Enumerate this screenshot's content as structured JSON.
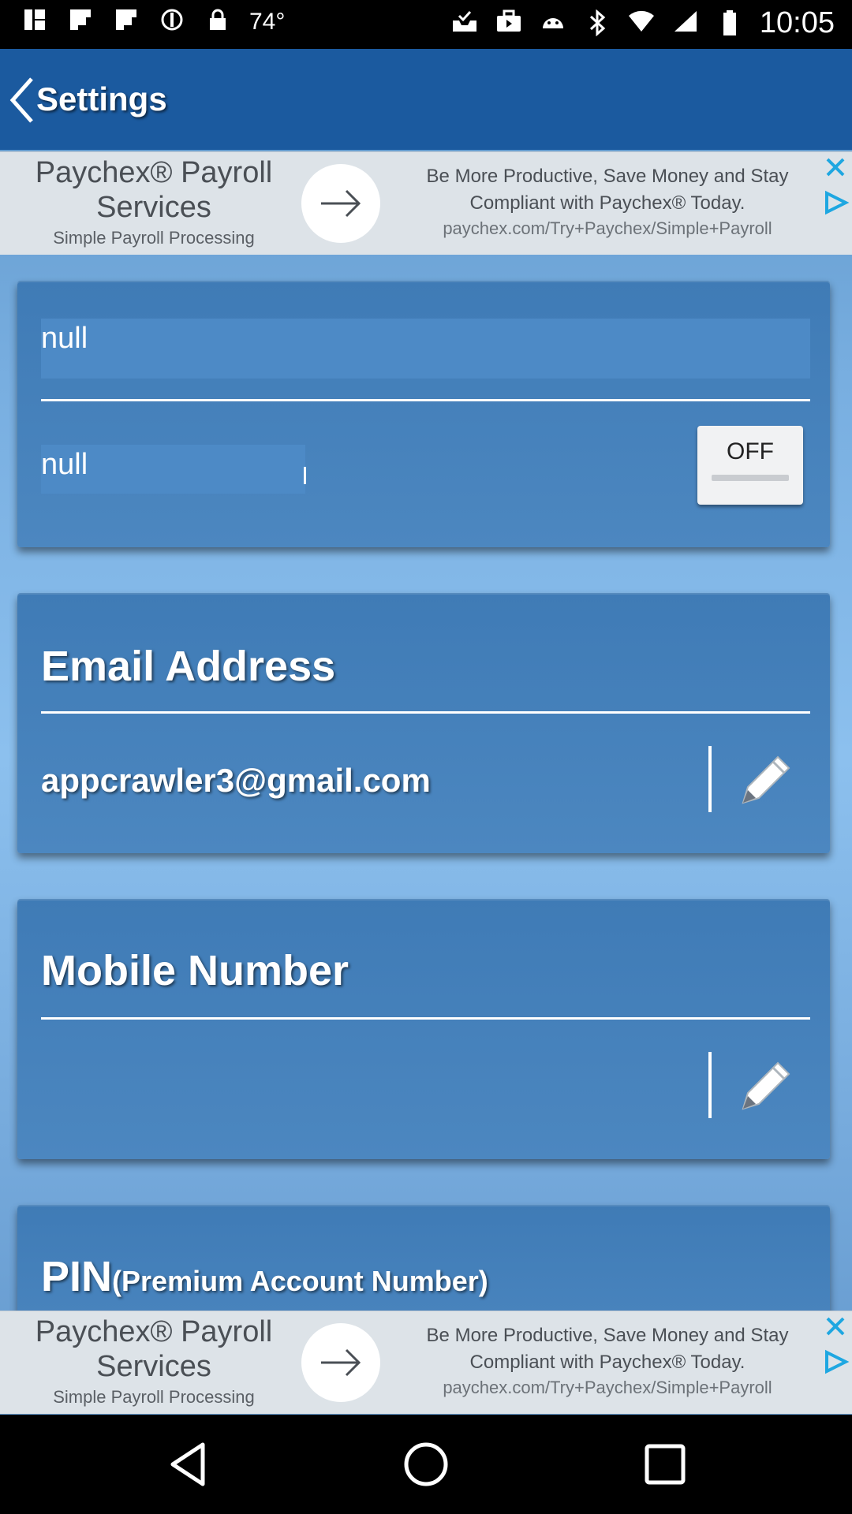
{
  "status_bar": {
    "left_icons": [
      "photo-icon",
      "flipboard-icon",
      "flipboard-icon",
      "pinwheel-icon",
      "lock-icon"
    ],
    "temperature": "74°",
    "right_icons": [
      "inbox-check-icon",
      "briefcase-icon",
      "android-icon",
      "bluetooth-icon",
      "wifi-icon",
      "signal-icon",
      "battery-icon"
    ],
    "time": "10:05"
  },
  "app_bar": {
    "title": "Settings"
  },
  "ad_top": {
    "title": "Paychex® Payroll Services",
    "subtitle": "Simple Payroll Processing",
    "body": "Be More Productive, Save Money and Stay Compliant with Paychex® Today.",
    "url": "paychex.com/Try+Paychex/Simple+Payroll"
  },
  "card1": {
    "field1": "null",
    "field2": "null",
    "toggle_label": "OFF"
  },
  "email": {
    "title": "Email Address",
    "value": "appcrawler3@gmail.com"
  },
  "mobile": {
    "title": "Mobile Number",
    "value": ""
  },
  "pin": {
    "title": "PIN",
    "subtitle": "(Premium Account Number)"
  },
  "ad_bottom": {
    "title": "Paychex® Payroll Services",
    "subtitle": "Simple Payroll Processing",
    "body": "Be More Productive, Save Money and Stay Compliant with Paychex® Today.",
    "url": "paychex.com/Try+Paychex/Simple+Payroll"
  },
  "colors": {
    "app_bar": "#1b5a9f",
    "card": "#4481bb",
    "ad_background": "#dde3e8",
    "ad_accent": "#1ea7e1"
  },
  "nav_bar": {
    "icons": [
      "back-triangle-icon",
      "home-circle-icon",
      "recents-square-icon"
    ]
  }
}
